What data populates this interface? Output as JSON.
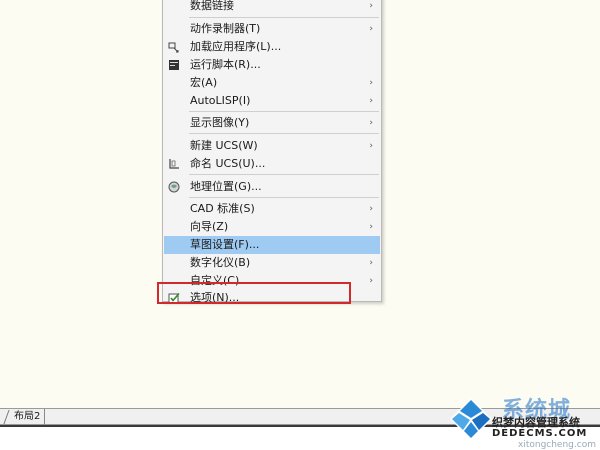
{
  "menu": {
    "items": [
      {
        "label": "数据链接",
        "arrow": "›"
      },
      {
        "label": "动作录制器(T)",
        "arrow": "›"
      },
      {
        "label": "加载应用程序(L)...",
        "icon": "load-application-icon"
      },
      {
        "label": "运行脚本(R)...",
        "icon": "run-script-icon"
      },
      {
        "label": "宏(A)",
        "arrow": "›"
      },
      {
        "label": "AutoLISP(I)",
        "arrow": "›"
      },
      {
        "label": "显示图像(Y)",
        "arrow": "›"
      },
      {
        "label": "新建 UCS(W)",
        "arrow": "›"
      },
      {
        "label": "命名 UCS(U)...",
        "icon": "named-ucs-icon"
      },
      {
        "label": "地理位置(G)...",
        "icon": "geolocation-icon"
      },
      {
        "label": "CAD 标准(S)",
        "arrow": "›"
      },
      {
        "label": "向导(Z)",
        "arrow": "›"
      },
      {
        "label": "草图设置(F)...",
        "highlighted": true
      },
      {
        "label": "数字化仪(B)",
        "arrow": "›"
      },
      {
        "label": "自定义(C)",
        "arrow": "›"
      },
      {
        "label": "选项(N)...",
        "icon": "options-check-icon"
      }
    ]
  },
  "tabs": {
    "layout2": "布局2"
  },
  "watermark": {
    "title": "系统城",
    "line1": "织梦内容管理系统",
    "line2": "DEDECMS.COM",
    "line3": "xitongcheng.com"
  },
  "colors": {
    "highlight": "#9fcbf2",
    "redbox": "#d22a2a",
    "canvas": "#fdfcf3"
  }
}
